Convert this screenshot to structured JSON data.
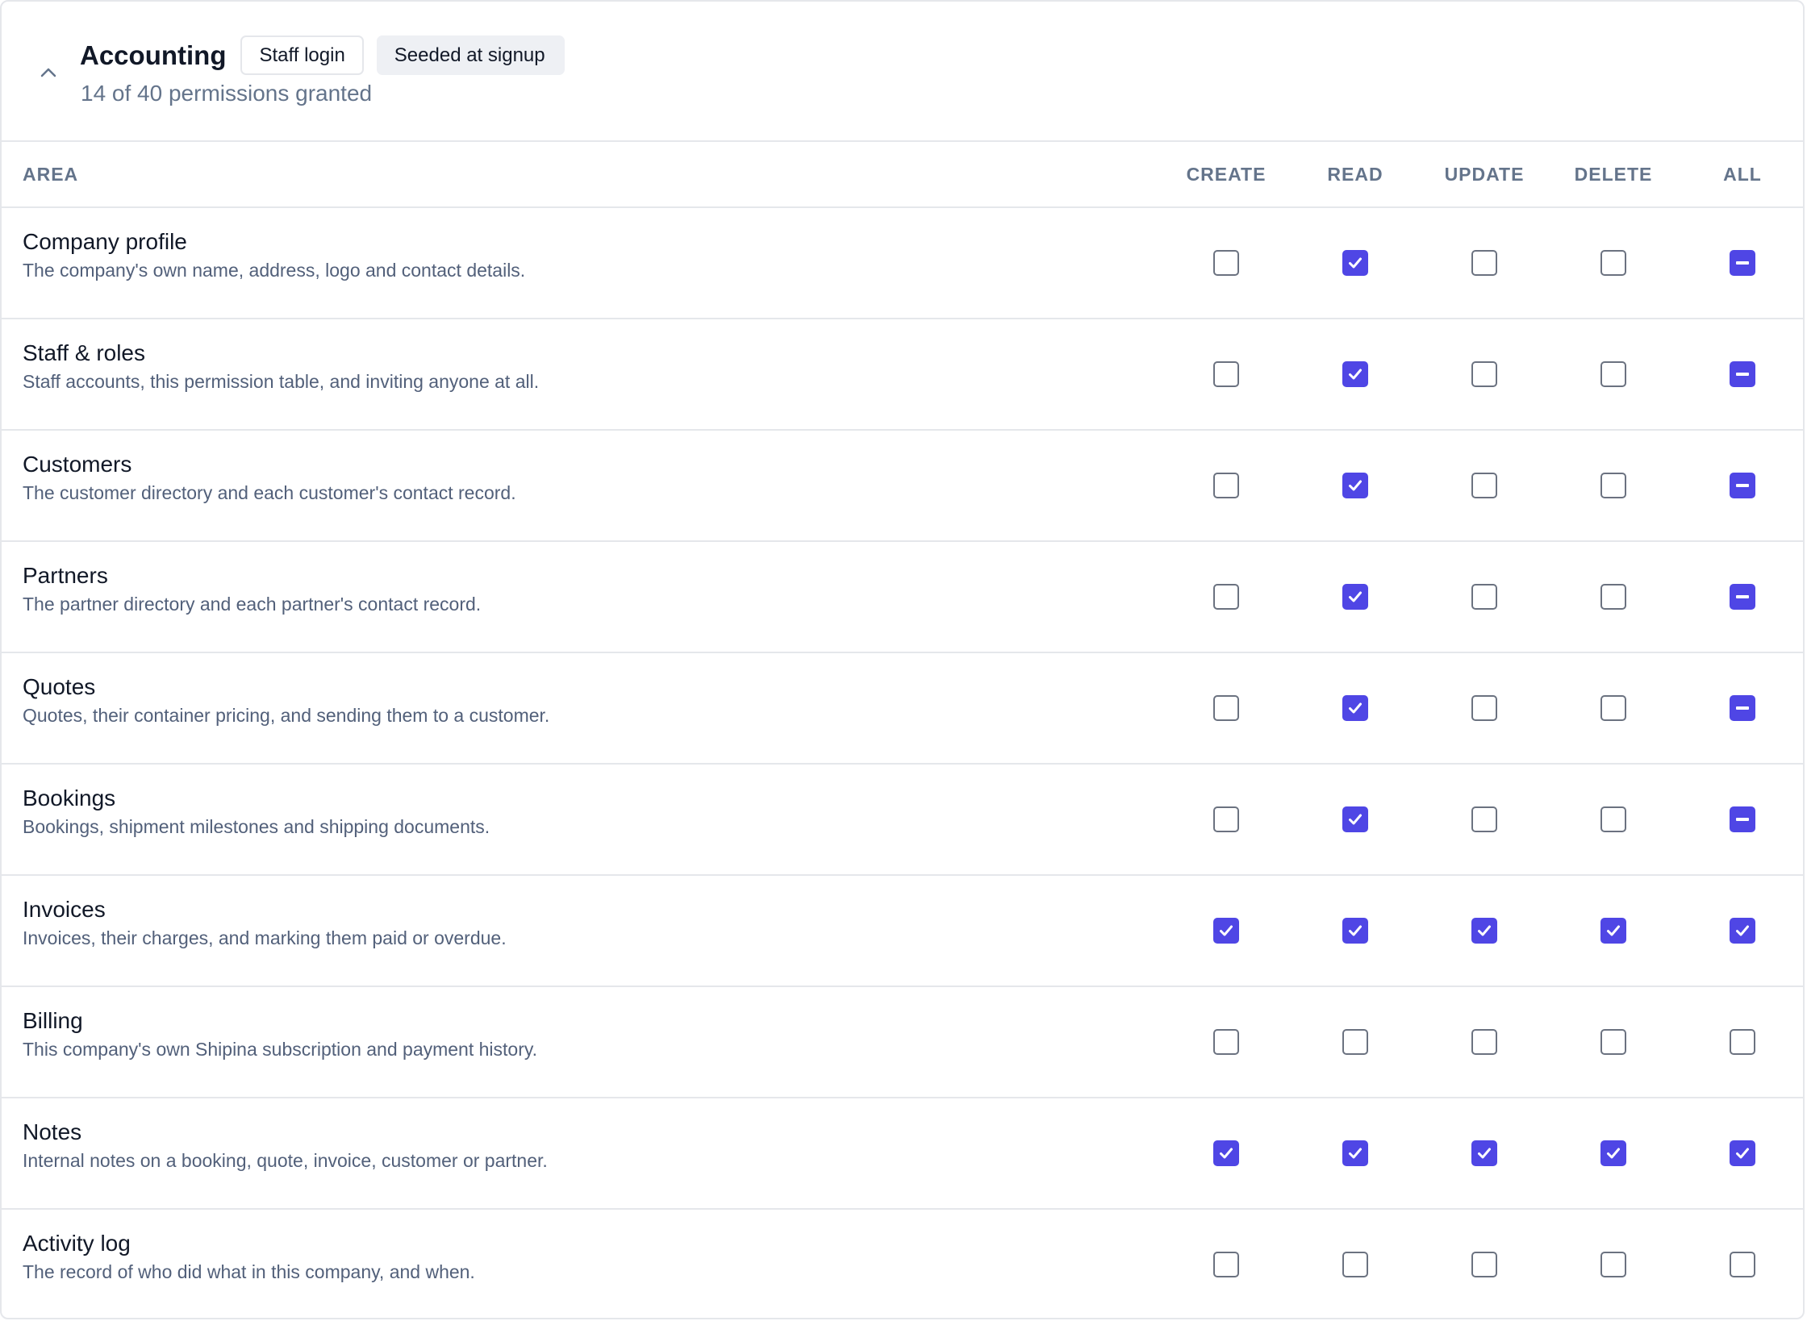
{
  "role": {
    "title": "Accounting",
    "badges": [
      "Staff login",
      "Seeded at signup"
    ],
    "summary": "14 of 40 permissions granted"
  },
  "table": {
    "headers": {
      "area": "AREA",
      "create": "CREATE",
      "read": "READ",
      "update": "UPDATE",
      "delete": "DELETE",
      "all": "ALL"
    },
    "rows": [
      {
        "name": "Company profile",
        "description": "The company's own name, address, logo and contact details.",
        "create": "off",
        "read": "on",
        "update": "off",
        "delete": "off",
        "all": "mixed"
      },
      {
        "name": "Staff & roles",
        "description": "Staff accounts, this permission table, and inviting anyone at all.",
        "create": "off",
        "read": "on",
        "update": "off",
        "delete": "off",
        "all": "mixed"
      },
      {
        "name": "Customers",
        "description": "The customer directory and each customer's contact record.",
        "create": "off",
        "read": "on",
        "update": "off",
        "delete": "off",
        "all": "mixed"
      },
      {
        "name": "Partners",
        "description": "The partner directory and each partner's contact record.",
        "create": "off",
        "read": "on",
        "update": "off",
        "delete": "off",
        "all": "mixed"
      },
      {
        "name": "Quotes",
        "description": "Quotes, their container pricing, and sending them to a customer.",
        "create": "off",
        "read": "on",
        "update": "off",
        "delete": "off",
        "all": "mixed"
      },
      {
        "name": "Bookings",
        "description": "Bookings, shipment milestones and shipping documents.",
        "create": "off",
        "read": "on",
        "update": "off",
        "delete": "off",
        "all": "mixed"
      },
      {
        "name": "Invoices",
        "description": "Invoices, their charges, and marking them paid or overdue.",
        "create": "on",
        "read": "on",
        "update": "on",
        "delete": "on",
        "all": "on"
      },
      {
        "name": "Billing",
        "description": "This company's own Shipina subscription and payment history.",
        "create": "off",
        "read": "off",
        "update": "off",
        "delete": "off",
        "all": "off"
      },
      {
        "name": "Notes",
        "description": "Internal notes on a booking, quote, invoice, customer or partner.",
        "create": "on",
        "read": "on",
        "update": "on",
        "delete": "on",
        "all": "on"
      },
      {
        "name": "Activity log",
        "description": "The record of who did what in this company, and when.",
        "create": "off",
        "read": "off",
        "update": "off",
        "delete": "off",
        "all": "off"
      }
    ]
  },
  "colors": {
    "accent": "#4f46e5",
    "border": "#e5e7eb",
    "muted_text": "#64748b"
  },
  "icons": {
    "collapse": "chevron-up-icon",
    "checked": "check-icon",
    "indeterminate": "minus-icon"
  }
}
